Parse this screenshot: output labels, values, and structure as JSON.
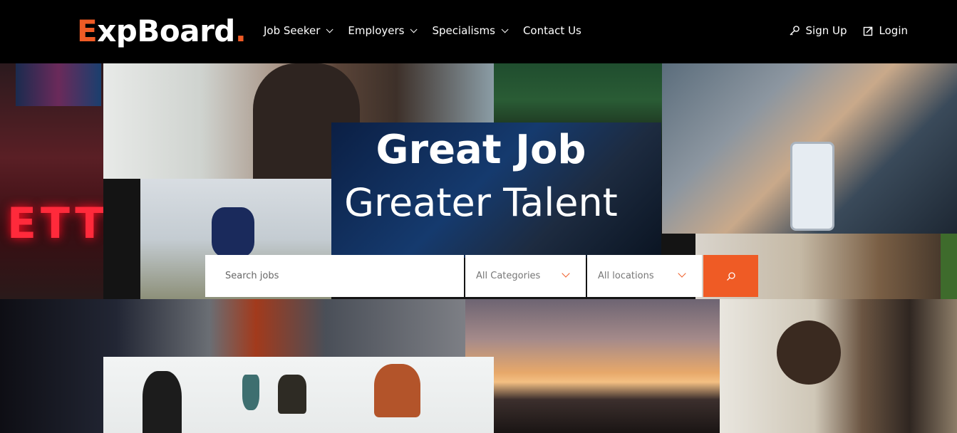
{
  "brand": {
    "logo_first": "E",
    "logo_rest": "xpBoard",
    "logo_dot": ".",
    "accent": "#ef5b25"
  },
  "nav": {
    "items": [
      {
        "label": "Job Seeker",
        "dropdown": true
      },
      {
        "label": "Employers",
        "dropdown": true
      },
      {
        "label": "Specialisms",
        "dropdown": true
      },
      {
        "label": "Contact Us",
        "dropdown": false
      }
    ]
  },
  "auth": {
    "signup_label": "Sign Up",
    "signup_icon": "key-icon",
    "login_label": "Login",
    "login_icon": "login-icon"
  },
  "hero": {
    "title": "Great Job",
    "subtitle": "Greater Talent"
  },
  "search": {
    "placeholder": "Search jobs",
    "category_selected": "All Categories",
    "location_selected": "All locations",
    "button_icon": "search-icon"
  }
}
